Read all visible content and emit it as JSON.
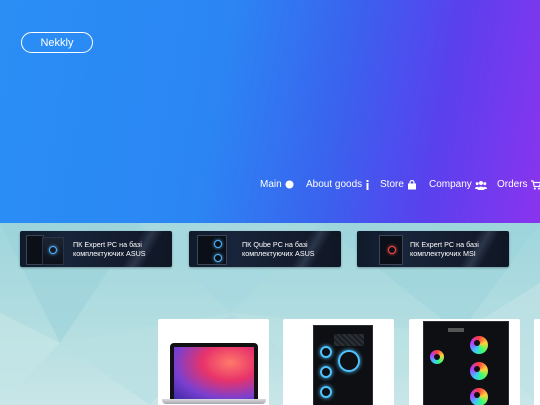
{
  "header": {
    "logo_label": "Nekkly"
  },
  "nav": {
    "items": [
      {
        "label": "Main",
        "icon": "circle-icon"
      },
      {
        "label": "About goods",
        "icon": "info-icon"
      },
      {
        "label": "Store",
        "icon": "shopping-bag-icon"
      },
      {
        "label": "Company",
        "icon": "users-icon"
      },
      {
        "label": "Orders",
        "icon": "cart-icon"
      }
    ]
  },
  "banners": [
    {
      "line1": "ПК Expert PC на базі",
      "line2": "комплектуючих ASUS"
    },
    {
      "line1": "ПК Qube PC на базі",
      "line2": "комплектуючих ASUS"
    },
    {
      "line1": "ПК Expert PC на базі",
      "line2": "комплектуючих MSI"
    }
  ],
  "colors": {
    "hero_start": "#2a8ef5",
    "hero_end": "#8a34ee",
    "lower_bg": "#a8d8de"
  }
}
